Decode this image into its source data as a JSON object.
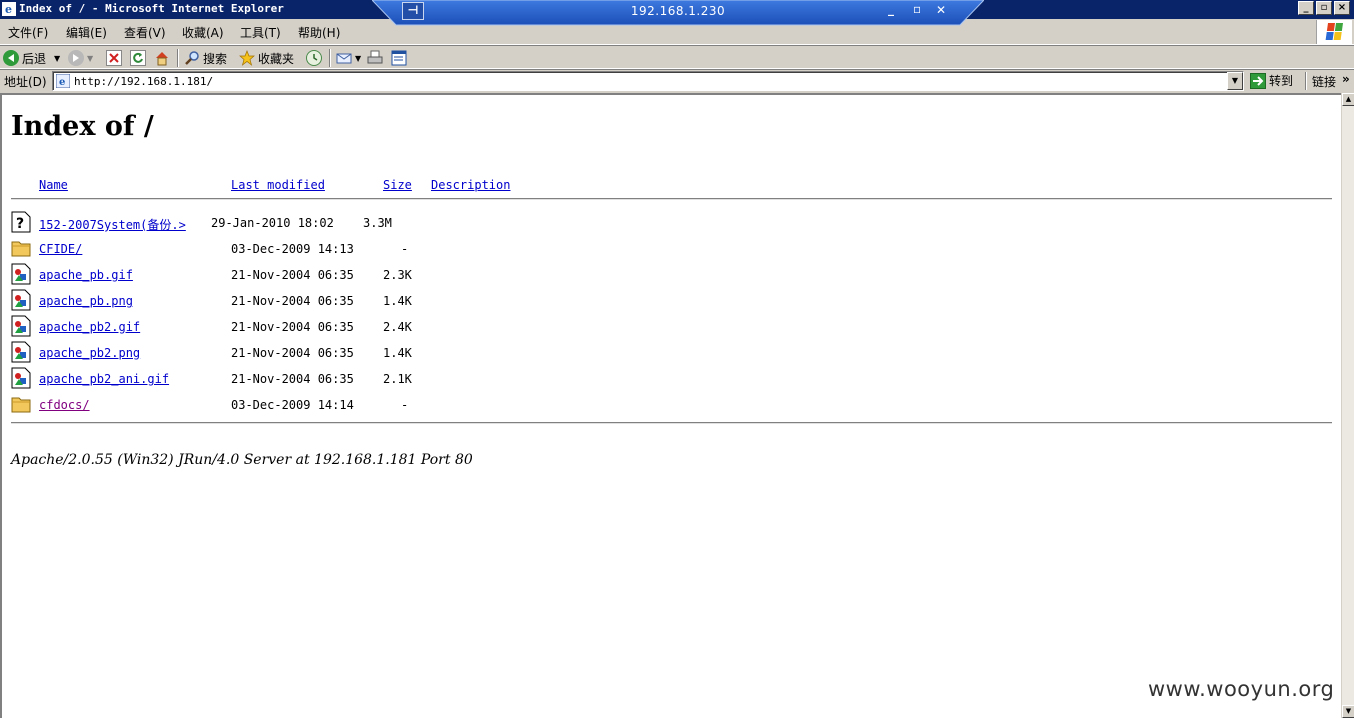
{
  "window": {
    "title": "Index of / - Microsoft Internet Explorer",
    "rdp_host": "192.168.1.230",
    "rdp_buttons": [
      "_",
      "▫",
      "✕"
    ],
    "buttons": [
      "_",
      "▫",
      "×"
    ]
  },
  "menu": [
    "文件(F)",
    "编辑(E)",
    "查看(V)",
    "收藏(A)",
    "工具(T)",
    "帮助(H)"
  ],
  "toolbar": {
    "back": "后退",
    "search": "搜索",
    "favorites": "收藏夹"
  },
  "address": {
    "label": "地址(D)",
    "url": "http://192.168.1.181/",
    "go": "转到",
    "links": "链接",
    "more": "»"
  },
  "page": {
    "heading": "Index of /",
    "columns": {
      "name": "Name",
      "modified": "Last modified",
      "size": "Size",
      "description": "Description"
    },
    "rows": [
      {
        "icon": "unknown-file-icon",
        "name": "152-2007System(备份.>",
        "modified": "29-Jan-2010 18:02",
        "size": "3.3M",
        "visited": false
      },
      {
        "icon": "folder-icon",
        "name": "CFIDE/",
        "modified": "03-Dec-2009 14:13",
        "size": "-",
        "visited": false
      },
      {
        "icon": "image-file-icon",
        "name": "apache_pb.gif",
        "modified": "21-Nov-2004 06:35",
        "size": "2.3K",
        "visited": false
      },
      {
        "icon": "image-file-icon",
        "name": "apache_pb.png",
        "modified": "21-Nov-2004 06:35",
        "size": "1.4K",
        "visited": false
      },
      {
        "icon": "image-file-icon",
        "name": "apache_pb2.gif",
        "modified": "21-Nov-2004 06:35",
        "size": "2.4K",
        "visited": false
      },
      {
        "icon": "image-file-icon",
        "name": "apache_pb2.png",
        "modified": "21-Nov-2004 06:35",
        "size": "1.4K",
        "visited": false
      },
      {
        "icon": "image-file-icon",
        "name": "apache_pb2_ani.gif",
        "modified": "21-Nov-2004 06:35",
        "size": "2.1K",
        "visited": false
      },
      {
        "icon": "folder-icon",
        "name": "cfdocs/",
        "modified": "03-Dec-2009 14:14",
        "size": "-",
        "visited": true
      }
    ],
    "footer": "Apache/2.0.55 (Win32) JRun/4.0 Server at 192.168.1.181 Port 80"
  },
  "watermark": "www.wooyun.org"
}
